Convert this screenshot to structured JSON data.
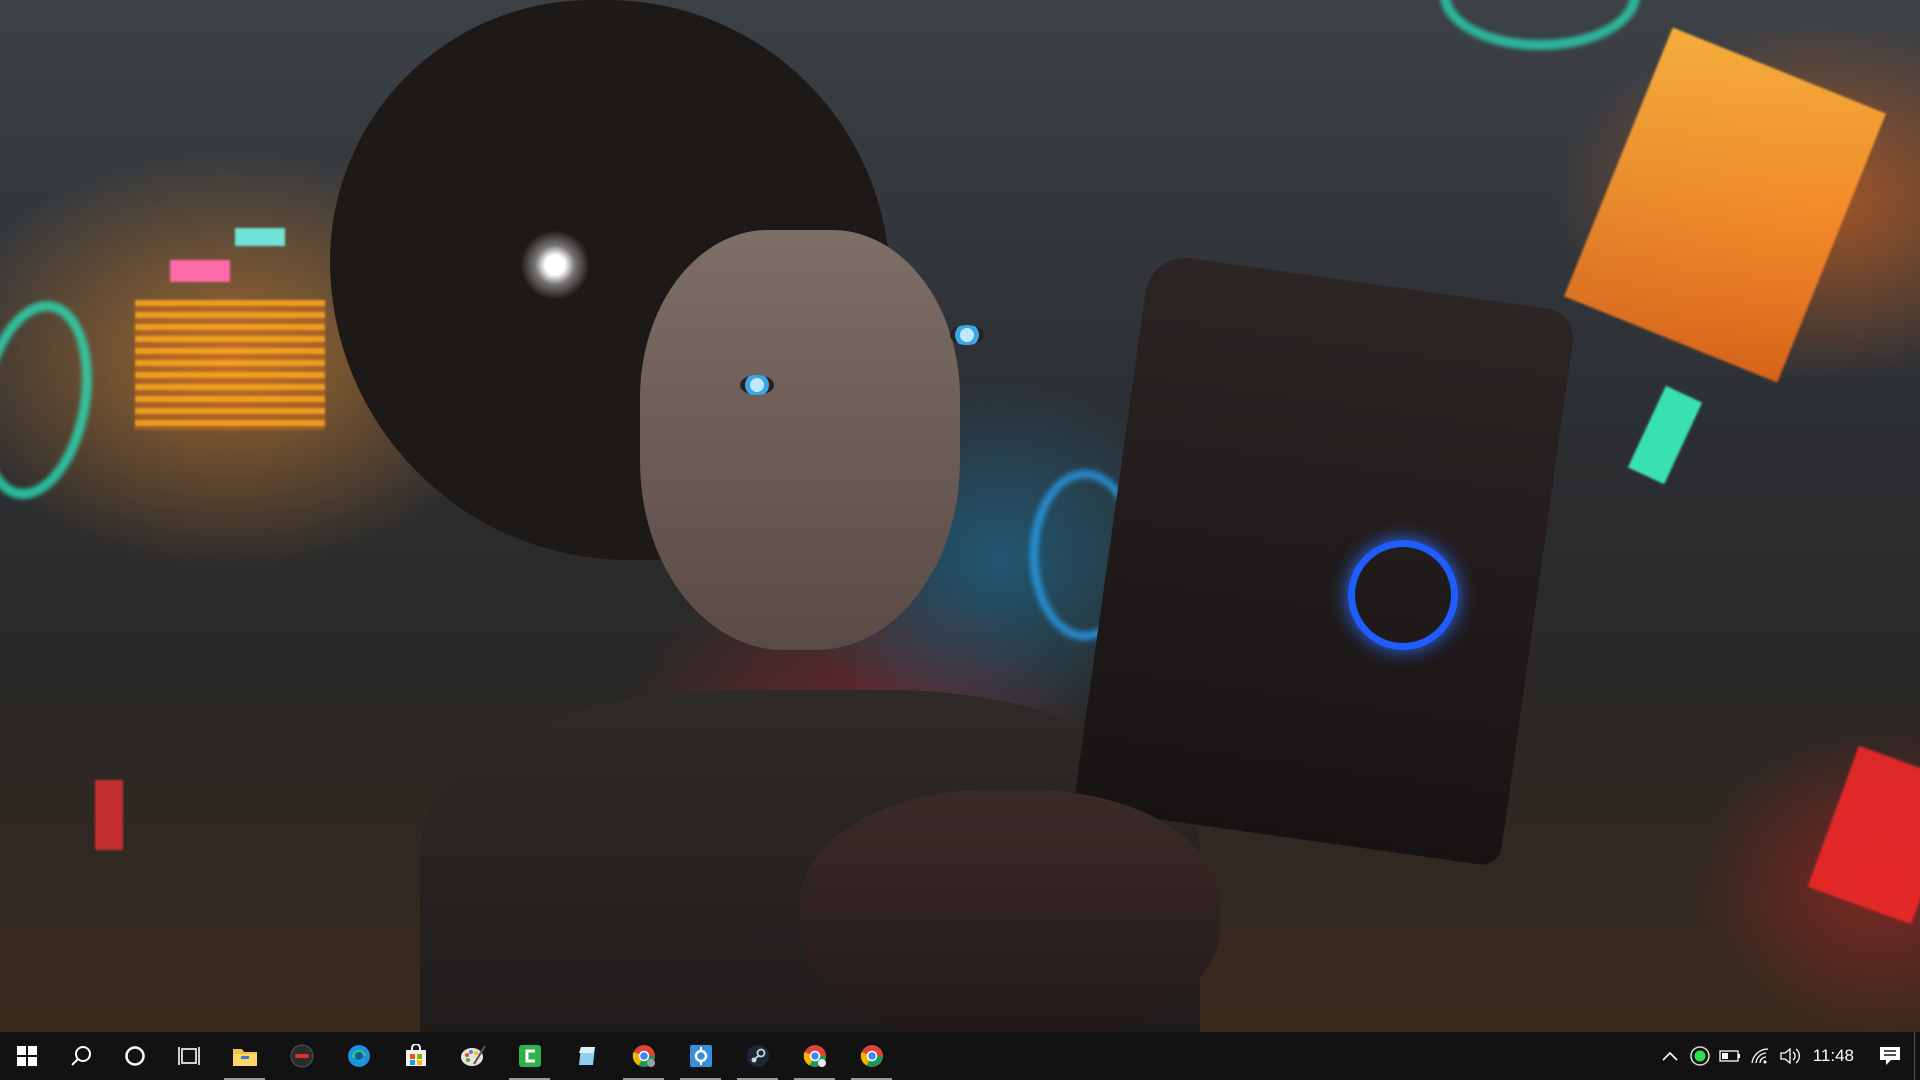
{
  "desktop": {
    "wallpaper": "cyberpunk-girl-with-pistol-neon-city-rain"
  },
  "taskbar": {
    "start_icon": "windows-start-icon",
    "search_icon": "search-icon",
    "cortana_icon": "cortana-icon",
    "task_view_icon": "task-view-icon",
    "pinned_apps": [
      {
        "name": "file-explorer",
        "running": true
      },
      {
        "name": "media-app",
        "running": false
      },
      {
        "name": "microsoft-edge",
        "running": false
      },
      {
        "name": "microsoft-store",
        "running": false
      },
      {
        "name": "paint",
        "running": false
      },
      {
        "name": "camtasia",
        "running": true
      },
      {
        "name": "app-blue",
        "running": false
      },
      {
        "name": "google-chrome-profile",
        "running": true
      },
      {
        "name": "settings-app",
        "running": true
      },
      {
        "name": "steam",
        "running": true
      },
      {
        "name": "google-chrome-2",
        "running": true
      },
      {
        "name": "google-chrome",
        "running": true
      }
    ],
    "tray": {
      "overflow_icon": "chevron-up-icon",
      "clock": "11:48",
      "notifications_icon": "action-center-icon"
    },
    "colors": {
      "background": "#121212",
      "running_indicator": "#9a9a9a"
    }
  }
}
